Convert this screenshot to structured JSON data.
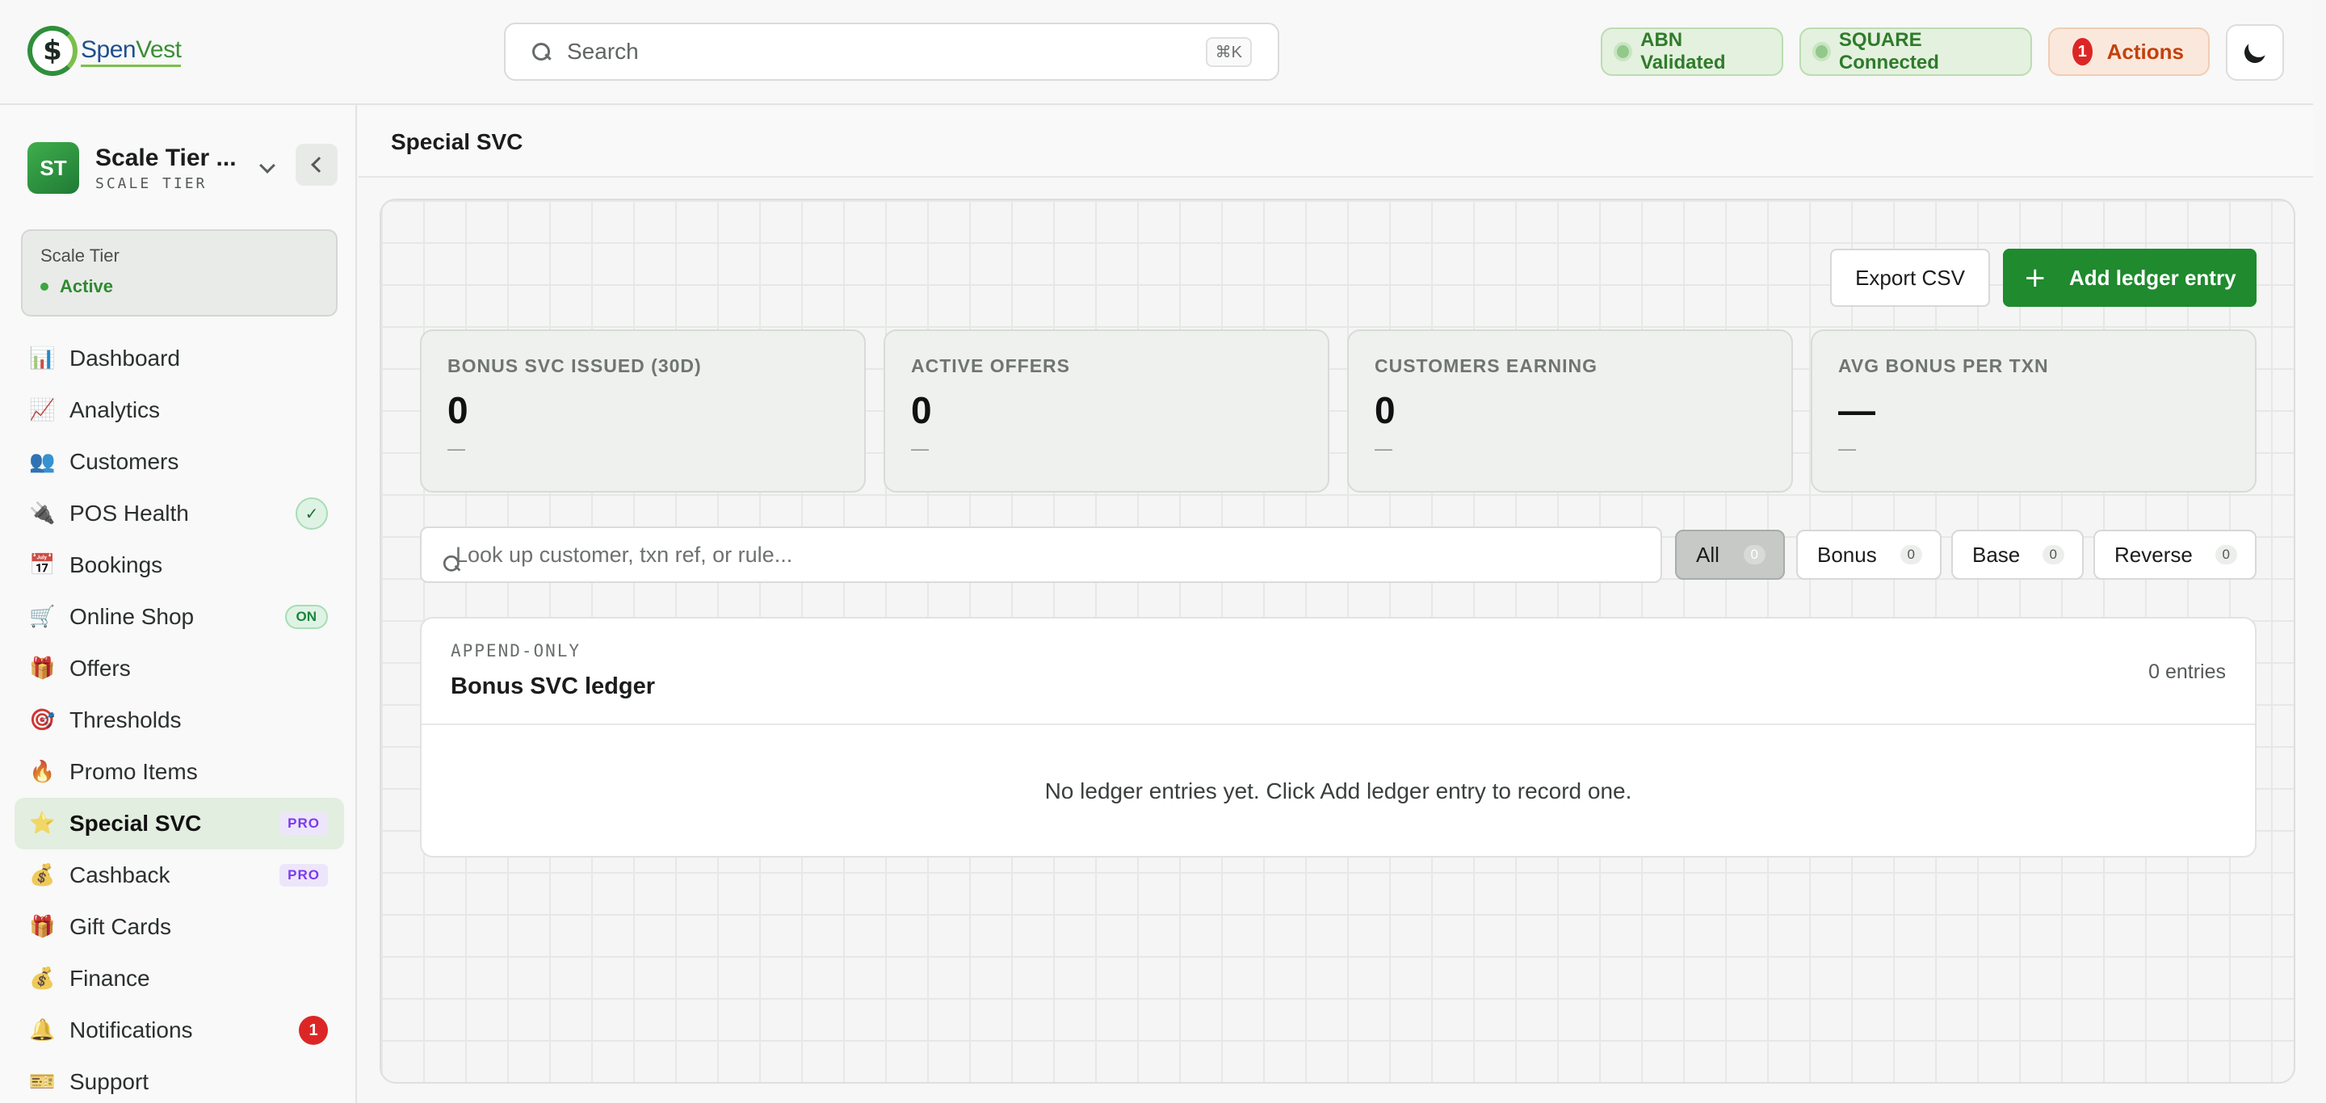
{
  "brand": {
    "logo_symbol": "$",
    "name_part1": "Spen",
    "name_part2": "Vest",
    "primary": "#1f8a2e"
  },
  "topbar": {
    "search_placeholder": "Search",
    "search_shortcut": "⌘K",
    "status_abn": "ABN Validated",
    "status_square": "SQUARE Connected",
    "actions_count": "1",
    "actions_label": "Actions",
    "theme_icon": "moon-icon"
  },
  "sidebar": {
    "tenant": {
      "initials": "ST",
      "name": "Scale Tier ...",
      "subtitle": "SCALE TIER"
    },
    "tier_card": {
      "title": "Scale Tier",
      "status": "Active"
    },
    "items": [
      {
        "icon": "📊",
        "label": "Dashboard"
      },
      {
        "icon": "📈",
        "label": "Analytics"
      },
      {
        "icon": "👥",
        "label": "Customers"
      },
      {
        "icon": "🔌",
        "label": "POS Health",
        "badge": "✓"
      },
      {
        "icon": "📅",
        "label": "Bookings"
      },
      {
        "icon": "🛒",
        "label": "Online Shop",
        "badge": "ON"
      },
      {
        "icon": "🎁",
        "label": "Offers"
      },
      {
        "icon": "🎯",
        "label": "Thresholds"
      },
      {
        "icon": "🔥",
        "label": "Promo Items"
      },
      {
        "icon": "⭐",
        "label": "Special SVC",
        "badge": "PRO"
      },
      {
        "icon": "💰",
        "label": "Cashback",
        "badge": "PRO"
      },
      {
        "icon": "🎁",
        "label": "Gift Cards"
      },
      {
        "icon": "💰",
        "label": "Finance"
      },
      {
        "icon": "🔔",
        "label": "Notifications",
        "badge": "1"
      },
      {
        "icon": "🎫",
        "label": "Support"
      }
    ]
  },
  "main": {
    "page_title": "Special SVC",
    "export_label": "Export CSV",
    "add_label": "Add ledger entry",
    "stats": [
      {
        "label": "BONUS SVC ISSUED (30D)",
        "value": "0",
        "sub": "—"
      },
      {
        "label": "ACTIVE OFFERS",
        "value": "0",
        "sub": "—"
      },
      {
        "label": "CUSTOMERS EARNING",
        "value": "0",
        "sub": "—"
      },
      {
        "label": "AVG BONUS PER TXN",
        "value": "—",
        "sub": "—"
      }
    ],
    "filter_placeholder": "Look up customer, txn ref, or rule...",
    "chips": [
      {
        "label": "All",
        "count": "0"
      },
      {
        "label": "Bonus",
        "count": "0"
      },
      {
        "label": "Base",
        "count": "0"
      },
      {
        "label": "Reverse",
        "count": "0"
      }
    ],
    "ledger": {
      "kicker": "APPEND-ONLY",
      "title": "Bonus SVC ledger",
      "count": "0 entries",
      "empty": "No ledger entries yet. Click Add ledger entry to record one."
    }
  }
}
